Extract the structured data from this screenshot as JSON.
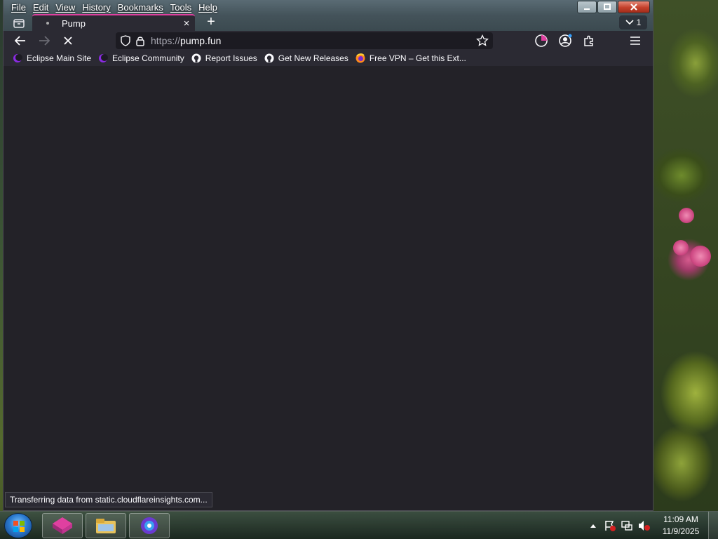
{
  "window": {
    "menu": [
      "File",
      "Edit",
      "View",
      "History",
      "Bookmarks",
      "Tools",
      "Help"
    ],
    "controls": {
      "minimize": "minimize",
      "maximize": "maximize",
      "close": "close"
    },
    "tab_count": "1"
  },
  "tab": {
    "title": "Pump",
    "close": "×",
    "new_tab": "+"
  },
  "urlbar": {
    "scheme": "https://",
    "host": "pump.fun"
  },
  "bookmarks": [
    {
      "label": "Eclipse Main Site",
      "icon": "eclipse-icon"
    },
    {
      "label": "Eclipse Community",
      "icon": "eclipse-icon"
    },
    {
      "label": "Report Issues",
      "icon": "github-icon"
    },
    {
      "label": "Get New Releases",
      "icon": "github-icon"
    },
    {
      "label": "Free VPN – Get this Ext...",
      "icon": "firefox-icon"
    }
  ],
  "status": {
    "text": "Transferring data from static.cloudflareinsights.com..."
  },
  "taskbar": {
    "time": "11:09 AM",
    "date": "11/9/2025"
  },
  "colors": {
    "accent": "#e040a0",
    "toolbar": "#2b2a33",
    "content": "#232228"
  }
}
